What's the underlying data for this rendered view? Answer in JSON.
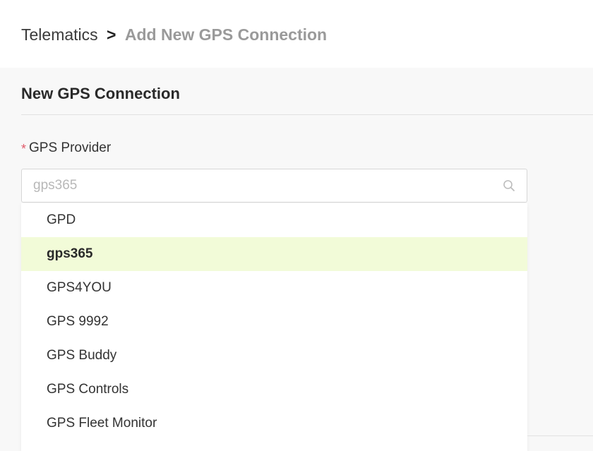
{
  "breadcrumb": {
    "root": "Telematics",
    "separator": ">",
    "current": "Add New GPS Connection"
  },
  "card": {
    "title": "New GPS Connection"
  },
  "gps_provider": {
    "required_mark": "*",
    "label": "GPS Provider",
    "placeholder": "gps365",
    "search_icon": "search-icon",
    "options": [
      {
        "label": "GPD",
        "selected": false
      },
      {
        "label": "gps365",
        "selected": true
      },
      {
        "label": "GPS4YOU",
        "selected": false
      },
      {
        "label": "GPS 9992",
        "selected": false
      },
      {
        "label": "GPS Buddy",
        "selected": false
      },
      {
        "label": "GPS Controls",
        "selected": false
      },
      {
        "label": "GPS Fleet Monitor",
        "selected": false
      }
    ]
  },
  "colors": {
    "highlight": "#f2fbd8",
    "required": "#e05a6a",
    "muted_text": "#9a9a9a"
  }
}
